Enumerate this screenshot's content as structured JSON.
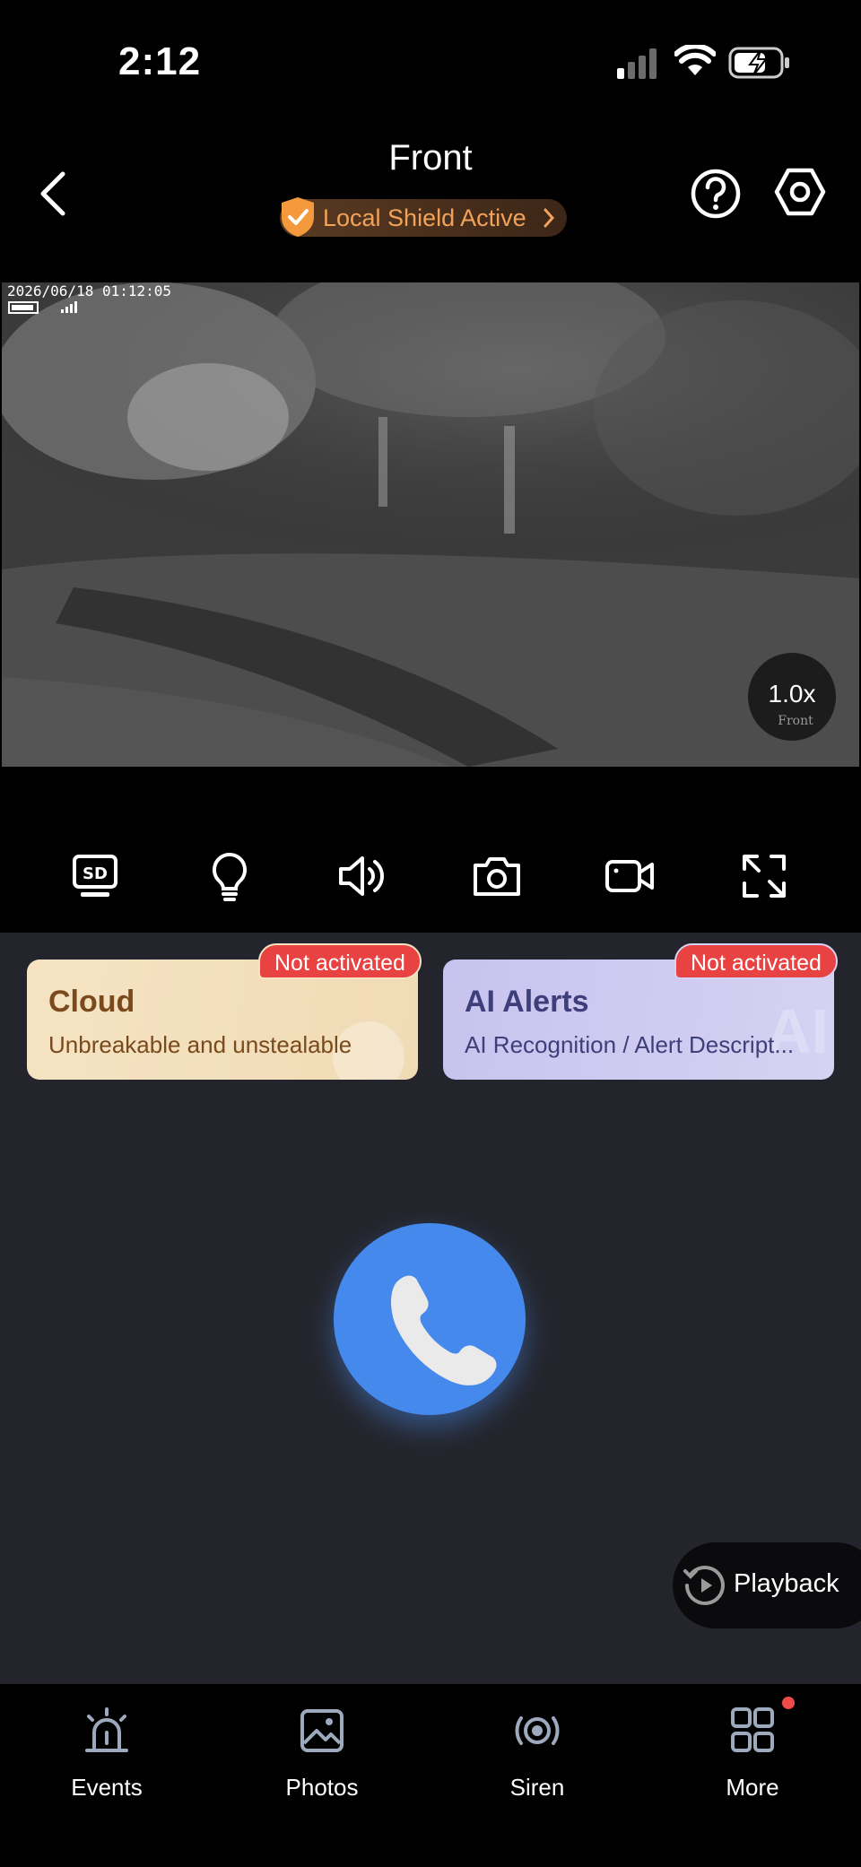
{
  "status_bar": {
    "time": "2:12"
  },
  "header": {
    "title": "Front",
    "shield_label": "Local Shield Active"
  },
  "video": {
    "timestamp": "2026/06/18 01:12:05",
    "zoom_level": "1.0x",
    "zoom_label": "Front"
  },
  "toolbar": {
    "icons": [
      "sd-icon",
      "light-bulb-icon",
      "speaker-icon",
      "camera-icon",
      "video-record-icon",
      "fullscreen-icon"
    ]
  },
  "cards": {
    "cloud": {
      "title": "Cloud",
      "subtitle": "Unbreakable and unstealable",
      "badge": "Not activated"
    },
    "ai": {
      "title": "AI Alerts",
      "subtitle": "AI Recognition / Alert Descript...",
      "badge": "Not activated"
    }
  },
  "playback_label": "Playback",
  "tabs": [
    {
      "label": "Events"
    },
    {
      "label": "Photos"
    },
    {
      "label": "Siren"
    },
    {
      "label": "More"
    }
  ],
  "colors": {
    "accent": "#4689ec",
    "badge": "#e94242",
    "shield": "#f2a259"
  }
}
